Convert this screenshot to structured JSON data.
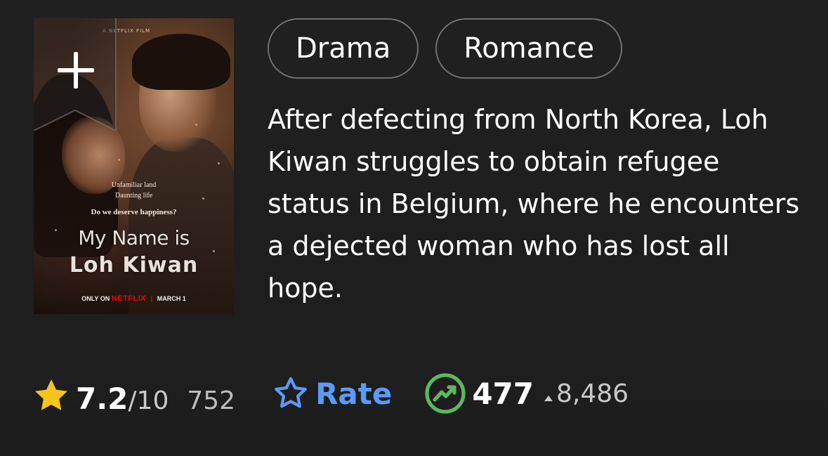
{
  "poster": {
    "badge": "A NETFLIX FILM",
    "tagline_1": "Unfamiliar land",
    "tagline_2": "Daunting life",
    "tagline_3": "Do we deserve happiness?",
    "title_line_1": "My Name is",
    "title_line_2": "Loh Kiwan",
    "only_on": "ONLY ON",
    "network": "NETFLIX",
    "date": "MARCH 1",
    "add_icon": "plus-icon"
  },
  "genres": [
    "Drama",
    "Romance"
  ],
  "description": "After defecting from North Korea, Loh Kiwan struggles to obtain refugee status in Belgium, where he encounters a dejected woman who has lost all hope.",
  "rating": {
    "icon": "star-icon",
    "value": "7.2",
    "max": "/10",
    "count": "752",
    "color": "#f5c518"
  },
  "rate": {
    "icon": "star-outline-icon",
    "label": "Rate",
    "color": "#5a9bf5"
  },
  "popularity": {
    "icon": "trending-up-icon",
    "value": "477",
    "delta": "8,486",
    "delta_direction": "up",
    "color": "#5cb85c"
  }
}
